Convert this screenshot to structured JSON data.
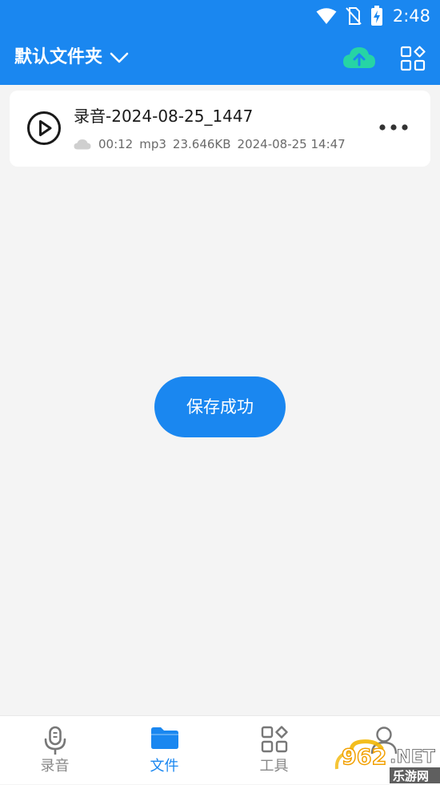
{
  "status_bar": {
    "time": "2:48",
    "icons": [
      "wifi-icon",
      "no-sim-icon",
      "battery-charging-icon"
    ]
  },
  "header": {
    "folder_title": "默认文件夹",
    "icons": [
      "chevron-down-icon",
      "cloud-upload-icon",
      "grid-apps-icon"
    ]
  },
  "file_list": [
    {
      "name": "录音-2024-08-25_1447",
      "duration": "00:12",
      "format": "mp3",
      "size": "23.646KB",
      "date": "2024-08-25 14:47",
      "icons": [
        "play-circle-icon",
        "cloud-icon",
        "more-horizontal-icon"
      ]
    }
  ],
  "toast": {
    "message": "保存成功"
  },
  "bottom_nav": {
    "items": [
      {
        "label": "录音",
        "icon": "microphone-icon",
        "active": false
      },
      {
        "label": "文件",
        "icon": "folder-icon",
        "active": true
      },
      {
        "label": "工具",
        "icon": "tools-grid-icon",
        "active": false
      },
      {
        "label": "",
        "icon": "user-icon",
        "active": false
      }
    ]
  },
  "watermark": {
    "text": "962.NET",
    "subtext": "乐游网"
  },
  "colors": {
    "primary": "#1a87f0",
    "cloud_upload": "#26d4a5",
    "background": "#f4f4f4",
    "card": "#ffffff",
    "text_primary": "#1a1a1a",
    "text_secondary": "#6a6a6a",
    "nav_inactive": "#888888"
  }
}
